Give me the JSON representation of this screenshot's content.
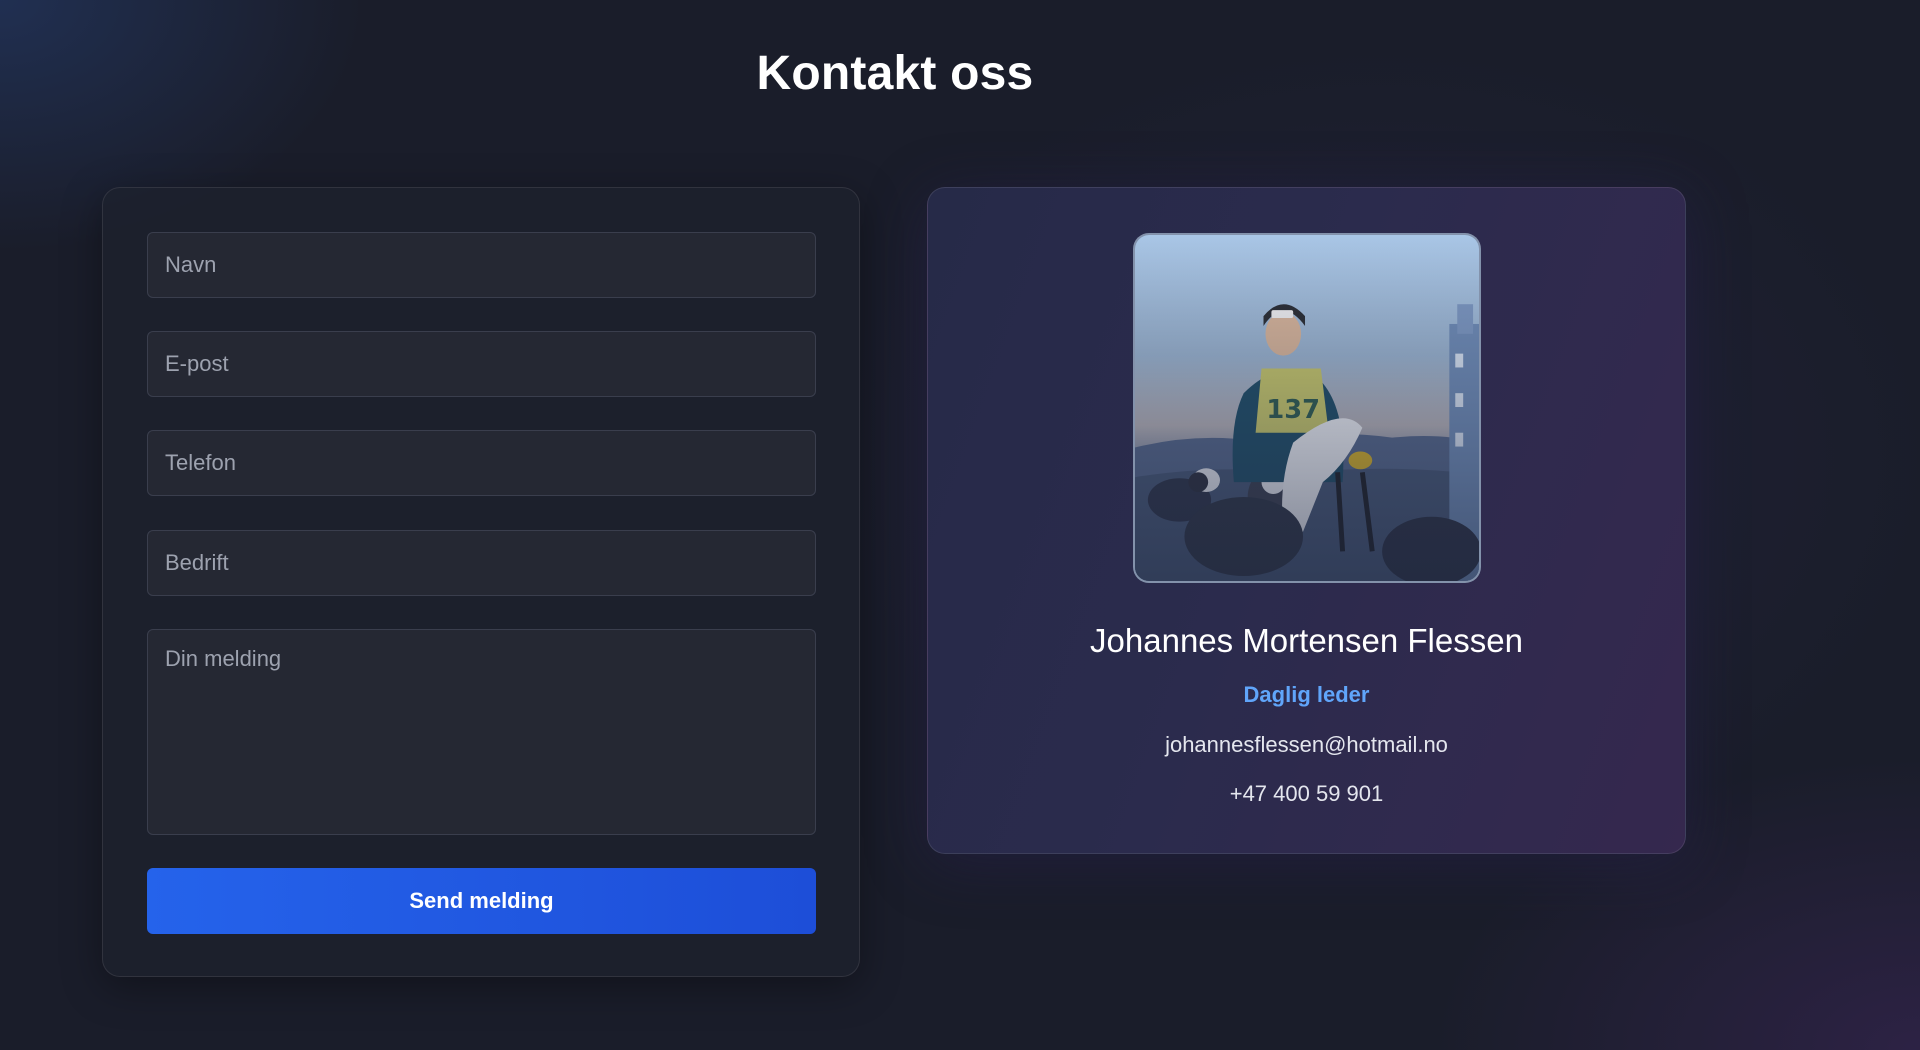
{
  "page": {
    "title": "Kontakt oss"
  },
  "form": {
    "fields": {
      "name": {
        "placeholder": "Navn",
        "value": ""
      },
      "email": {
        "placeholder": "E-post",
        "value": ""
      },
      "phone": {
        "placeholder": "Telefon",
        "value": ""
      },
      "company": {
        "placeholder": "Bedrift",
        "value": ""
      },
      "message": {
        "placeholder": "Din melding",
        "value": ""
      }
    },
    "submit_label": "Send melding"
  },
  "contact": {
    "photo_label": "Johannes Mortensen Flessen",
    "bib_number": "137",
    "name": "Johannes Mortensen Flessen",
    "role": "Daglig leder",
    "email": "johannesflessen@hotmail.no",
    "phone": "+47 400 59 901"
  },
  "colors": {
    "background": "#1a1d2a",
    "accent": "#2563eb",
    "role_text": "#60a5fa",
    "field_bg": "#252833"
  }
}
